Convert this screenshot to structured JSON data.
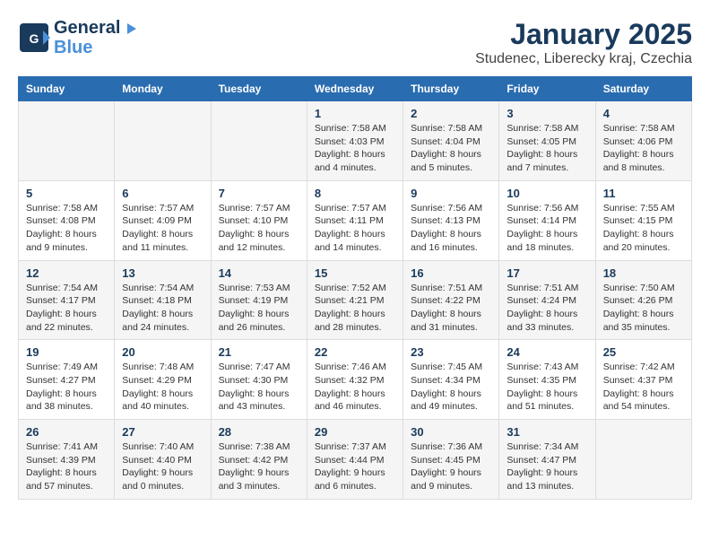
{
  "logo": {
    "line1": "General",
    "line2": "Blue"
  },
  "title": "January 2025",
  "subtitle": "Studenec, Liberecky kraj, Czechia",
  "weekdays": [
    "Sunday",
    "Monday",
    "Tuesday",
    "Wednesday",
    "Thursday",
    "Friday",
    "Saturday"
  ],
  "weeks": [
    [
      {
        "day": "",
        "info": ""
      },
      {
        "day": "",
        "info": ""
      },
      {
        "day": "",
        "info": ""
      },
      {
        "day": "1",
        "info": "Sunrise: 7:58 AM\nSunset: 4:03 PM\nDaylight: 8 hours\nand 4 minutes."
      },
      {
        "day": "2",
        "info": "Sunrise: 7:58 AM\nSunset: 4:04 PM\nDaylight: 8 hours\nand 5 minutes."
      },
      {
        "day": "3",
        "info": "Sunrise: 7:58 AM\nSunset: 4:05 PM\nDaylight: 8 hours\nand 7 minutes."
      },
      {
        "day": "4",
        "info": "Sunrise: 7:58 AM\nSunset: 4:06 PM\nDaylight: 8 hours\nand 8 minutes."
      }
    ],
    [
      {
        "day": "5",
        "info": "Sunrise: 7:58 AM\nSunset: 4:08 PM\nDaylight: 8 hours\nand 9 minutes."
      },
      {
        "day": "6",
        "info": "Sunrise: 7:57 AM\nSunset: 4:09 PM\nDaylight: 8 hours\nand 11 minutes."
      },
      {
        "day": "7",
        "info": "Sunrise: 7:57 AM\nSunset: 4:10 PM\nDaylight: 8 hours\nand 12 minutes."
      },
      {
        "day": "8",
        "info": "Sunrise: 7:57 AM\nSunset: 4:11 PM\nDaylight: 8 hours\nand 14 minutes."
      },
      {
        "day": "9",
        "info": "Sunrise: 7:56 AM\nSunset: 4:13 PM\nDaylight: 8 hours\nand 16 minutes."
      },
      {
        "day": "10",
        "info": "Sunrise: 7:56 AM\nSunset: 4:14 PM\nDaylight: 8 hours\nand 18 minutes."
      },
      {
        "day": "11",
        "info": "Sunrise: 7:55 AM\nSunset: 4:15 PM\nDaylight: 8 hours\nand 20 minutes."
      }
    ],
    [
      {
        "day": "12",
        "info": "Sunrise: 7:54 AM\nSunset: 4:17 PM\nDaylight: 8 hours\nand 22 minutes."
      },
      {
        "day": "13",
        "info": "Sunrise: 7:54 AM\nSunset: 4:18 PM\nDaylight: 8 hours\nand 24 minutes."
      },
      {
        "day": "14",
        "info": "Sunrise: 7:53 AM\nSunset: 4:19 PM\nDaylight: 8 hours\nand 26 minutes."
      },
      {
        "day": "15",
        "info": "Sunrise: 7:52 AM\nSunset: 4:21 PM\nDaylight: 8 hours\nand 28 minutes."
      },
      {
        "day": "16",
        "info": "Sunrise: 7:51 AM\nSunset: 4:22 PM\nDaylight: 8 hours\nand 31 minutes."
      },
      {
        "day": "17",
        "info": "Sunrise: 7:51 AM\nSunset: 4:24 PM\nDaylight: 8 hours\nand 33 minutes."
      },
      {
        "day": "18",
        "info": "Sunrise: 7:50 AM\nSunset: 4:26 PM\nDaylight: 8 hours\nand 35 minutes."
      }
    ],
    [
      {
        "day": "19",
        "info": "Sunrise: 7:49 AM\nSunset: 4:27 PM\nDaylight: 8 hours\nand 38 minutes."
      },
      {
        "day": "20",
        "info": "Sunrise: 7:48 AM\nSunset: 4:29 PM\nDaylight: 8 hours\nand 40 minutes."
      },
      {
        "day": "21",
        "info": "Sunrise: 7:47 AM\nSunset: 4:30 PM\nDaylight: 8 hours\nand 43 minutes."
      },
      {
        "day": "22",
        "info": "Sunrise: 7:46 AM\nSunset: 4:32 PM\nDaylight: 8 hours\nand 46 minutes."
      },
      {
        "day": "23",
        "info": "Sunrise: 7:45 AM\nSunset: 4:34 PM\nDaylight: 8 hours\nand 49 minutes."
      },
      {
        "day": "24",
        "info": "Sunrise: 7:43 AM\nSunset: 4:35 PM\nDaylight: 8 hours\nand 51 minutes."
      },
      {
        "day": "25",
        "info": "Sunrise: 7:42 AM\nSunset: 4:37 PM\nDaylight: 8 hours\nand 54 minutes."
      }
    ],
    [
      {
        "day": "26",
        "info": "Sunrise: 7:41 AM\nSunset: 4:39 PM\nDaylight: 8 hours\nand 57 minutes."
      },
      {
        "day": "27",
        "info": "Sunrise: 7:40 AM\nSunset: 4:40 PM\nDaylight: 9 hours\nand 0 minutes."
      },
      {
        "day": "28",
        "info": "Sunrise: 7:38 AM\nSunset: 4:42 PM\nDaylight: 9 hours\nand 3 minutes."
      },
      {
        "day": "29",
        "info": "Sunrise: 7:37 AM\nSunset: 4:44 PM\nDaylight: 9 hours\nand 6 minutes."
      },
      {
        "day": "30",
        "info": "Sunrise: 7:36 AM\nSunset: 4:45 PM\nDaylight: 9 hours\nand 9 minutes."
      },
      {
        "day": "31",
        "info": "Sunrise: 7:34 AM\nSunset: 4:47 PM\nDaylight: 9 hours\nand 13 minutes."
      },
      {
        "day": "",
        "info": ""
      }
    ]
  ]
}
